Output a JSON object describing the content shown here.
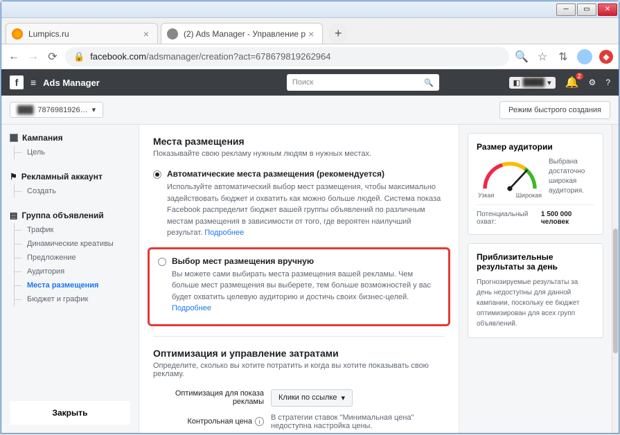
{
  "tabs": [
    {
      "title": "Lumpics.ru"
    },
    {
      "title": "(2) Ads Manager - Управление р"
    }
  ],
  "url": {
    "domain": "facebook.com",
    "path": "/adsmanager/creation?act=678679819262964"
  },
  "fb": {
    "product": "Ads Manager",
    "search_placeholder": "Поиск",
    "notif_count": "2",
    "account_id": "7876981926…",
    "mode_button": "Режим быстрого создания"
  },
  "nav": {
    "campaign": {
      "title": "Кампания",
      "items": [
        "Цель"
      ]
    },
    "adaccount": {
      "title": "Рекламный аккаунт",
      "items": [
        "Создать"
      ]
    },
    "adset": {
      "title": "Группа объявлений",
      "items": [
        "Трафик",
        "Динамические креативы",
        "Предложение",
        "Аудитория",
        "Места размещения",
        "Бюджет и график"
      ],
      "active_index": 4
    },
    "close": "Закрыть"
  },
  "main": {
    "placements": {
      "title": "Места размещения",
      "subtitle": "Показывайте свою рекламу нужным людям в нужных местах.",
      "auto": {
        "label": "Автоматические места размещения (рекомендуется)",
        "desc": "Используйте автоматический выбор мест размещения, чтобы максимально задействовать бюджет и охватить как можно больше людей. Система показа Facebook распределит бюджет вашей группы объявлений по различным местам размещения в зависимости от того, где вероятен наилучший результат. ",
        "more": "Подробнее"
      },
      "manual": {
        "label": "Выбор мест размещения вручную",
        "desc": "Вы можете сами выбирать места размещения вашей рекламы. Чем больше мест размещения вы выберете, тем больше возможностей у вас будет охватить целевую аудиторию и достичь своих бизнес-целей. ",
        "more": "Подробнее"
      }
    },
    "optimization": {
      "title": "Оптимизация и управление затратами",
      "subtitle": "Определите, сколько вы хотите потратить и когда вы хотите показывать свою рекламу.",
      "delivery_label": "Оптимизация для показа рекламы",
      "delivery_value": "Клики по ссылке",
      "price_label": "Контрольная цена",
      "price_desc": "В стратегии ставок \"Минимальная цена\" недоступна настройка цены."
    }
  },
  "right": {
    "audience": {
      "title": "Размер аудитории",
      "narrow": "Узкая",
      "wide": "Широкая",
      "summary": "Выбрана достаточно широкая аудитория.",
      "reach_label": "Потенциальный охват:",
      "reach_value": "1 500 000 человек"
    },
    "results": {
      "title": "Приблизительные результаты за день",
      "desc": "Прогнозируемые результаты за день недоступны для данной кампании, поскольку ее бюджет оптимизирован для всех групп объявлений."
    }
  }
}
